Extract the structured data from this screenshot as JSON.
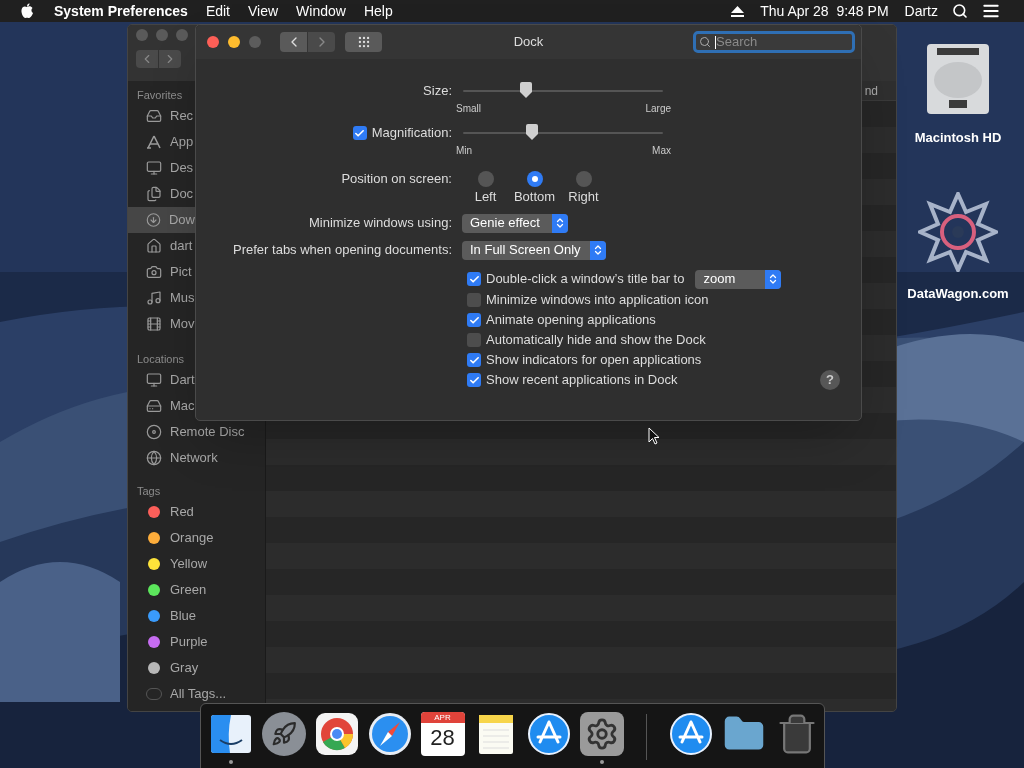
{
  "menu_bar": {
    "app": "System Preferences",
    "menus": [
      "Edit",
      "View",
      "Window",
      "Help"
    ],
    "clock": "Thu Apr 28  9:48 PM",
    "user": "Dartz"
  },
  "finder": {
    "column_header": "nd",
    "sidebar": [
      {
        "heading": "Favorites",
        "items": [
          {
            "label": "Rec",
            "selected": false
          },
          {
            "label": "App",
            "selected": false
          },
          {
            "label": "Des",
            "selected": false
          },
          {
            "label": "Doc",
            "selected": false
          },
          {
            "label": "Dow",
            "selected": true
          },
          {
            "label": "dart",
            "selected": false
          },
          {
            "label": "Pict",
            "selected": false
          },
          {
            "label": "Mus",
            "selected": false
          },
          {
            "label": "Mov",
            "selected": false
          }
        ]
      },
      {
        "heading": "Locations",
        "items": [
          {
            "label": "Dart",
            "selected": false
          },
          {
            "label": "Mac",
            "selected": false
          },
          {
            "label": "Remote Disc",
            "selected": false
          },
          {
            "label": "Network",
            "selected": false
          }
        ]
      },
      {
        "heading": "Tags",
        "items": [
          {
            "label": "Red",
            "selected": false,
            "color": "#fc5f5a"
          },
          {
            "label": "Orange",
            "selected": false,
            "color": "#fdad3b"
          },
          {
            "label": "Yellow",
            "selected": false,
            "color": "#fde33a"
          },
          {
            "label": "Green",
            "selected": false,
            "color": "#5ce65c"
          },
          {
            "label": "Blue",
            "selected": false,
            "color": "#3a9bfb"
          },
          {
            "label": "Purple",
            "selected": false,
            "color": "#c66cf1"
          },
          {
            "label": "Gray",
            "selected": false,
            "color": "#b7b7b7"
          },
          {
            "label": "All Tags...",
            "selected": false,
            "kind": "all"
          }
        ]
      }
    ]
  },
  "prefs": {
    "title": "Dock",
    "search": {
      "placeholder": "Search"
    },
    "sliders": [
      {
        "label": "Size:",
        "level": 0.315,
        "min_label": "Small",
        "max_label": "Large"
      },
      {
        "label": "Magnification:",
        "checked": true,
        "level": 0.345,
        "min_label": "Min",
        "max_label": "Max"
      }
    ],
    "position": {
      "label": "Position on screen:",
      "options": [
        {
          "label": "Left",
          "selected": false
        },
        {
          "label": "Bottom",
          "selected": true
        },
        {
          "label": "Right",
          "selected": false
        }
      ]
    },
    "popups": [
      {
        "label": "Minimize windows using:",
        "value": "Genie effect"
      },
      {
        "label": "Prefer tabs when opening documents:",
        "value": "In Full Screen Only"
      }
    ],
    "checkboxes": [
      {
        "label": "Double-click a window’s title bar to",
        "checked": true,
        "popup": "zoom"
      },
      {
        "label": "Minimize windows into application icon",
        "checked": false
      },
      {
        "label": "Animate opening applications",
        "checked": true
      },
      {
        "label": "Automatically hide and show the Dock",
        "checked": false
      },
      {
        "label": "Show indicators for open applications",
        "checked": true
      },
      {
        "label": "Show recent applications in Dock",
        "checked": true
      }
    ],
    "help": "?"
  },
  "desktop_icons": [
    {
      "label": "Macintosh HD",
      "kind": "drive"
    },
    {
      "label": "DataWagon.com",
      "kind": "pattern"
    }
  ],
  "dock": [
    {
      "kind": "finder",
      "running": true
    },
    {
      "kind": "launchpad",
      "running": false
    },
    {
      "kind": "chrome",
      "running": false
    },
    {
      "kind": "safari",
      "running": false
    },
    {
      "kind": "calendar",
      "running": false,
      "month": "APR",
      "day": "28"
    },
    {
      "kind": "notes",
      "running": false
    },
    {
      "kind": "appstore",
      "running": false
    },
    {
      "kind": "prefs",
      "running": true
    },
    {
      "kind": "separator"
    },
    {
      "kind": "appstore",
      "running": false
    },
    {
      "kind": "folder",
      "running": false
    },
    {
      "kind": "trash",
      "running": false
    }
  ]
}
